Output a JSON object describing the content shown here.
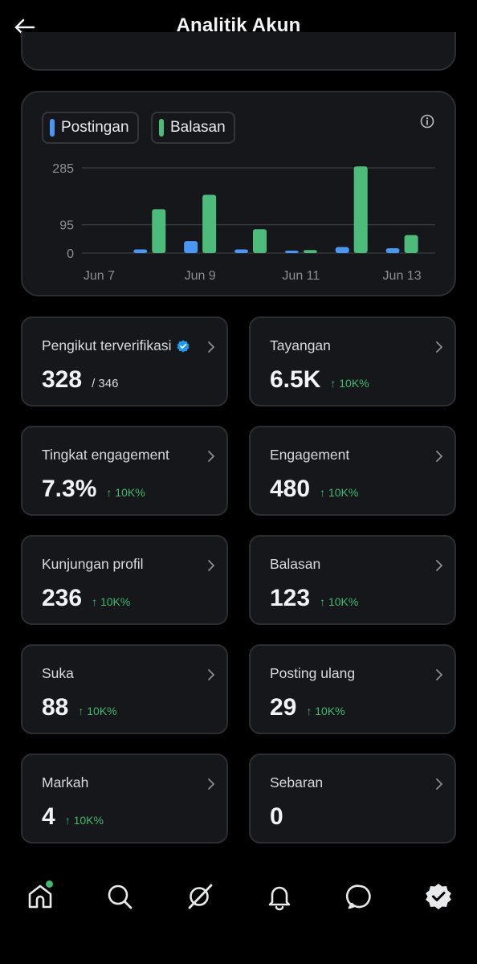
{
  "header": {
    "title": "Analitik Akun"
  },
  "legend": [
    {
      "label": "Postingan",
      "color": "#4a97f2"
    },
    {
      "label": "Balasan",
      "color": "#4dbb7a"
    }
  ],
  "chart_data": {
    "type": "bar",
    "categories": [
      "Jun 7",
      "Jun 8",
      "Jun 9",
      "Jun 10",
      "Jun 11",
      "Jun 12",
      "Jun 13"
    ],
    "x_tick_labels": [
      "Jun 7",
      "Jun 9",
      "Jun 11",
      "Jun 13"
    ],
    "y_tick_labels": [
      "285",
      "95",
      "0"
    ],
    "y_ticks": [
      285,
      95,
      0
    ],
    "ylim": [
      0,
      285
    ],
    "grid": true,
    "legend_position": "top-left",
    "series": [
      {
        "name": "Postingan",
        "color": "#4a97f2",
        "values": [
          0,
          12,
          40,
          12,
          2,
          20,
          16
        ]
      },
      {
        "name": "Balasan",
        "color": "#4dbb7a",
        "values": [
          0,
          147,
          195,
          80,
          10,
          290,
          60
        ]
      }
    ]
  },
  "stats": [
    {
      "label": "Pengikut terverifikasi",
      "value": "328",
      "sub": "/ 346",
      "change": "",
      "verified": true
    },
    {
      "label": "Tayangan",
      "value": "6.5K",
      "sub": "",
      "change": "↑ 10K%"
    },
    {
      "label": "Tingkat engagement",
      "value": "7.3%",
      "sub": "",
      "change": "↑ 10K%"
    },
    {
      "label": "Engagement",
      "value": "480",
      "sub": "",
      "change": "↑ 10K%"
    },
    {
      "label": "Kunjungan profil",
      "value": "236",
      "sub": "",
      "change": "↑ 10K%"
    },
    {
      "label": "Balasan",
      "value": "123",
      "sub": "",
      "change": "↑ 10K%"
    },
    {
      "label": "Suka",
      "value": "88",
      "sub": "",
      "change": "↑ 10K%"
    },
    {
      "label": "Posting ulang",
      "value": "29",
      "sub": "",
      "change": "↑ 10K%"
    },
    {
      "label": "Markah",
      "value": "4",
      "sub": "",
      "change": "↑ 10K%"
    },
    {
      "label": "Sebaran",
      "value": "0",
      "sub": "",
      "change": ""
    }
  ],
  "nav": [
    "home-icon",
    "search-icon",
    "grok-icon",
    "bell-icon",
    "messages-icon",
    "verified-icon"
  ],
  "colors": {
    "accent_green": "#3fb96e",
    "verified_blue": "#1d9bf0"
  }
}
